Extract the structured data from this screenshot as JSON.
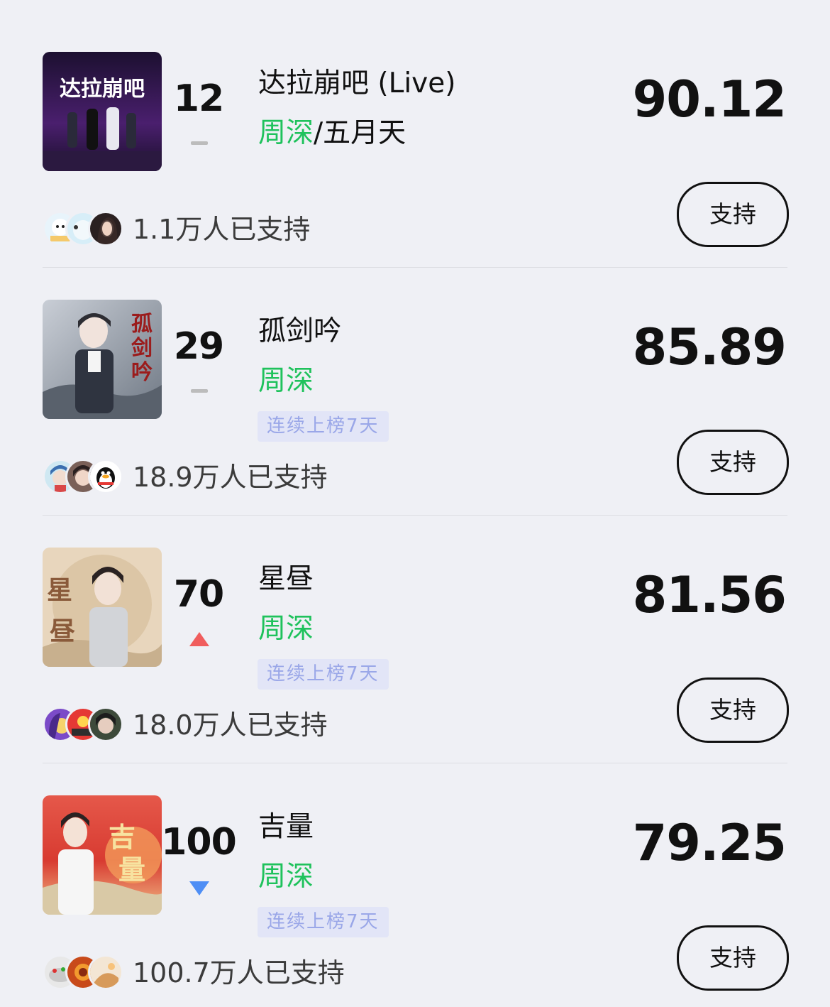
{
  "colors": {
    "background": "#eff0f5",
    "artist_green": "#1fc25c",
    "trend_up": "#f05d5d",
    "trend_down": "#4e8ef5",
    "trend_flat": "#bcbcbc",
    "streak_bg": "#e2e5f7",
    "streak_text": "#9aa7e8"
  },
  "items": [
    {
      "rank": "12",
      "trend": "flat",
      "title": "达拉崩吧 (Live)",
      "artist_main": "周深",
      "artist_sep": "/",
      "artist_other": "五月天",
      "streak": "",
      "score": "90.12",
      "supporters": "1.1万人已支持",
      "support_label": "支持",
      "cover_text": "达拉崩吧"
    },
    {
      "rank": "29",
      "trend": "flat",
      "title": "孤剑吟",
      "artist_main": "周深",
      "artist_sep": "",
      "artist_other": "",
      "streak": "连续上榜7天",
      "score": "85.89",
      "supporters": "18.9万人已支持",
      "support_label": "支持",
      "cover_text": "孤剑吟"
    },
    {
      "rank": "70",
      "trend": "up",
      "title": "星昼",
      "artist_main": "周深",
      "artist_sep": "",
      "artist_other": "",
      "streak": "连续上榜7天",
      "score": "81.56",
      "supporters": "18.0万人已支持",
      "support_label": "支持",
      "cover_text": "星昼"
    },
    {
      "rank": "100",
      "trend": "down",
      "title": "吉量",
      "artist_main": "周深",
      "artist_sep": "",
      "artist_other": "",
      "streak": "连续上榜7天",
      "score": "79.25",
      "supporters": "100.7万人已支持",
      "support_label": "支持",
      "cover_text": "吉量"
    }
  ]
}
